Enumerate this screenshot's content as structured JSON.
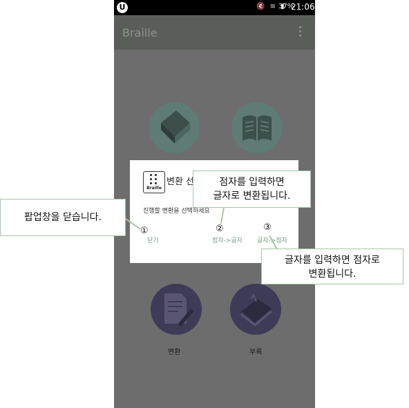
{
  "statusbar": {
    "app_icon": "U",
    "status_icons": "mute-icon wifi-icon signal-icon",
    "battery": "37%",
    "time": "21:06"
  },
  "appbar": {
    "title": "Braille"
  },
  "tiles": [
    {
      "icon": "book-icon"
    },
    {
      "icon": "open-book-icon"
    },
    {
      "icon": "pen-document-icon",
      "label": "변환"
    },
    {
      "icon": "notebook-icon",
      "label": "부록"
    }
  ],
  "dialog": {
    "logo_text": "Braille",
    "title": "변환 선택",
    "message": "진행할 변환을 선택하세요",
    "buttons": {
      "close": "닫기",
      "dots_to_text": "점자->글자",
      "text_to_dots": "글자->점자"
    }
  },
  "annotations": {
    "num1": "①",
    "num2": "②",
    "num3": "③",
    "callout_close": "팝업창을 닫습니다.",
    "callout_dots_line1": "점자를 입력하면",
    "callout_dots_line2": "글자로 변환됩니다.",
    "callout_text_line1": "글자를 입력하면 점자로",
    "callout_text_line2": "변환됩니다."
  },
  "colors": {
    "overlay_bg": "#6d6d6d",
    "tile_top": "#5e7b74",
    "tile_bottom": "#3e3b56",
    "callout_border": "#a9c3ad",
    "button_text": "#7a9c88"
  }
}
